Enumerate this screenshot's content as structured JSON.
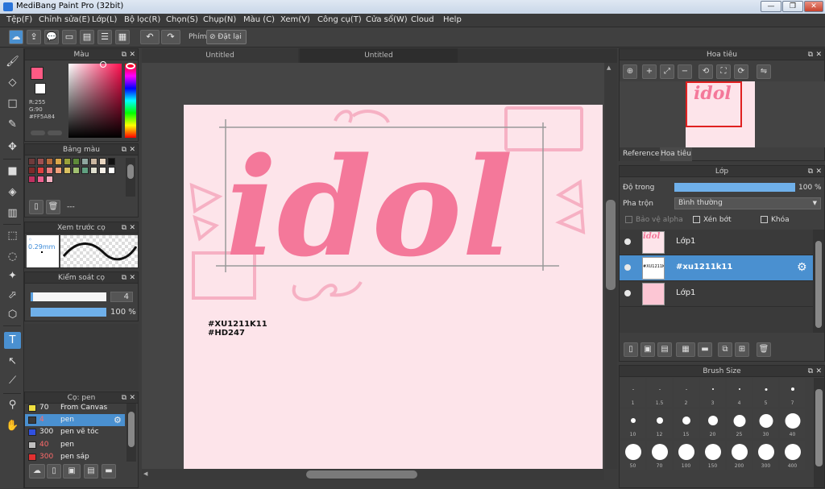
{
  "titlebar": {
    "title": "MediBang Paint Pro (32bit)",
    "min": "—",
    "max": "❐",
    "close": "✕"
  },
  "menu": [
    "Tệp(F)",
    "Chỉnh sửa(E)",
    "Lớp(L)",
    "Bộ lọc(R)",
    "Chọn(S)",
    "Chụp(N)",
    "Màu (C)",
    "Xem(V)",
    "Công cụ(T)",
    "Cửa sổ(W)",
    "Cloud",
    "Help"
  ],
  "toolbar": {
    "keys_label": "Phím",
    "reset_label": "Đặt lại"
  },
  "tabs": [
    "Untitled",
    "Untitled"
  ],
  "color_panel": {
    "title": "Màu",
    "r": "R:255",
    "g": "G:90",
    "hex": "#FF5A84",
    "primary": "#ff5a84"
  },
  "palette_panel": {
    "title": "Bảng màu",
    "footer": "---",
    "colors": [
      "#6e3b3b",
      "#a05050",
      "#b86c3c",
      "#d9a64a",
      "#9aa23a",
      "#5e8a3a",
      "#8fa7a0",
      "#c9b6a0",
      "#e8d6c0",
      "#111111",
      "#7e2a2a",
      "#e04040",
      "#e87c7c",
      "#f0a07a",
      "#d8c060",
      "#a0c070",
      "#60a080",
      "#e0e0d0",
      "#f5f0e8",
      "#ffffff",
      "#c03060",
      "#f06090",
      "#f4b0c0"
    ]
  },
  "preview_panel": {
    "title": "Xem trước cọ",
    "size": "0.29mm"
  },
  "brushctl_panel": {
    "title": "Kiểm soát cọ",
    "size": "4",
    "opacity": "100 %"
  },
  "pen_panel": {
    "title": "Cọ: pen",
    "rows": [
      {
        "num": "70",
        "name": "From Canvas",
        "color": "#f0e040"
      },
      {
        "num": "4",
        "name": "pen",
        "color": "#3a3a3a",
        "active": true
      },
      {
        "num": "300",
        "name": "pen vẽ tóc",
        "color": "#3050e0"
      },
      {
        "num": "40",
        "name": "pen",
        "color": "#c0c0c0"
      },
      {
        "num": "300",
        "name": "pen sáp",
        "color": "#e03030"
      }
    ]
  },
  "canvas": {
    "word": "idol",
    "tag1": "#XU1211K11",
    "tag2": "#HD247"
  },
  "navigator": {
    "title": "Hoa tiêu",
    "tab_ref": "Reference",
    "tab_nav": "Hoa tiêu"
  },
  "layer_panel": {
    "title": "Lớp",
    "opacity_label": "Độ trong",
    "opacity_value": "100 %",
    "blend_label": "Pha trộn",
    "blend_value": "Bình thường",
    "protect_alpha": "Bảo vệ alpha",
    "clip": "Xén bớt",
    "lock": "Khóa",
    "layers": [
      {
        "name": "Lớp1",
        "selected": false
      },
      {
        "name": "#xu1211k11",
        "selected": true
      },
      {
        "name": "Lớp1",
        "selected": false
      }
    ]
  },
  "brush_size_panel": {
    "title": "Brush Size",
    "row1": [
      "1",
      "1.5",
      "2",
      "3",
      "4",
      "5",
      "7"
    ],
    "row2": [
      "10",
      "12",
      "15",
      "20",
      "25",
      "30",
      "40"
    ],
    "row3": [
      "50",
      "70",
      "100",
      "150",
      "200",
      "300",
      "400"
    ]
  }
}
